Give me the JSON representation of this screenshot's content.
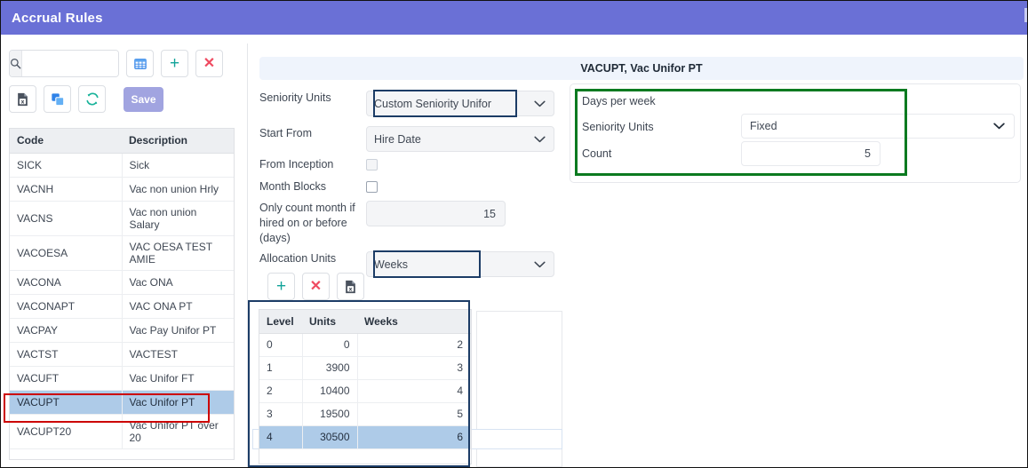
{
  "window": {
    "title": "Accrual Rules",
    "header_color": "#6a70d6"
  },
  "left_panel": {
    "search": {
      "value": "",
      "placeholder": "",
      "icon": "search-icon"
    },
    "toolbar_top": [
      {
        "name": "grid-view-button",
        "icon": "grid-icon",
        "label": ""
      },
      {
        "name": "add-button",
        "icon": "plus-icon",
        "label": "+"
      },
      {
        "name": "delete-button",
        "icon": "cross-icon",
        "label": "✕"
      }
    ],
    "toolbar_bottom": [
      {
        "name": "export-excel-button",
        "icon": "excel-file-icon",
        "label": ""
      },
      {
        "name": "copy-button",
        "icon": "copy-icon",
        "label": ""
      },
      {
        "name": "refresh-button",
        "icon": "refresh-icon",
        "label": ""
      }
    ],
    "save_label": "Save",
    "grid": {
      "columns": [
        "Code",
        "Description"
      ],
      "rows": [
        {
          "code": "SICK",
          "description": "Sick",
          "selected": false
        },
        {
          "code": "VACNH",
          "description": "Vac non union Hrly",
          "selected": false
        },
        {
          "code": "VACNS",
          "description": "Vac non union Salary",
          "selected": false
        },
        {
          "code": "VACOESA",
          "description": "VAC OESA TEST AMIE",
          "selected": false
        },
        {
          "code": "VACONA",
          "description": "Vac ONA",
          "selected": false
        },
        {
          "code": "VACONAPT",
          "description": "VAC ONA PT",
          "selected": false
        },
        {
          "code": "VACPAY",
          "description": "Vac Pay Unifor PT",
          "selected": false
        },
        {
          "code": "VACTST",
          "description": "VACTEST",
          "selected": false
        },
        {
          "code": "VACUFT",
          "description": "Vac Unifor FT",
          "selected": false
        },
        {
          "code": "VACUPT",
          "description": "Vac Unifor PT",
          "selected": true
        },
        {
          "code": "VACUPT20",
          "description": "Vac Unifor PT over 20",
          "selected": false
        }
      ]
    }
  },
  "main_panel": {
    "record_title": "VACUPT, Vac Unifor PT",
    "fields": {
      "seniority_units": {
        "label": "Seniority Units",
        "value": "Custom Seniority Unifor"
      },
      "start_from": {
        "label": "Start From",
        "value": "Hire Date"
      },
      "from_inception": {
        "label": "From Inception",
        "checked": false
      },
      "month_blocks": {
        "label": "Month Blocks",
        "checked": false
      },
      "only_count_month": {
        "label": "Only count month if hired  on or before (days)",
        "value": "15"
      },
      "allocation_units": {
        "label": "Allocation Units",
        "value": "Weeks"
      }
    },
    "action_buttons": [
      {
        "name": "add-allocation-button",
        "icon": "plus-icon",
        "label": "+"
      },
      {
        "name": "delete-allocation-button",
        "icon": "cross-icon",
        "label": "✕"
      },
      {
        "name": "export-allocation-button",
        "icon": "excel-file-icon",
        "label": ""
      }
    ],
    "allocation_table": {
      "columns": [
        "Level",
        "Units",
        "Weeks"
      ],
      "rows": [
        {
          "level": "0",
          "units": "0",
          "weeks": "2",
          "selected": false
        },
        {
          "level": "1",
          "units": "3900",
          "weeks": "3",
          "selected": false
        },
        {
          "level": "2",
          "units": "10400",
          "weeks": "4",
          "selected": false
        },
        {
          "level": "3",
          "units": "19500",
          "weeks": "5",
          "selected": false
        },
        {
          "level": "4",
          "units": "30500",
          "weeks": "6",
          "selected": true
        }
      ]
    },
    "days_per_week_card": {
      "title": "Days per week",
      "seniority_units": {
        "label": "Seniority Units",
        "value": "Fixed"
      },
      "count": {
        "label": "Count",
        "value": "5"
      }
    }
  },
  "annotations": {
    "red_outline_color": "#cc0000",
    "navy_outline_color": "#1c3c66",
    "green_outline_color": "#0b7a20",
    "selection_color": "#aecbe8"
  }
}
